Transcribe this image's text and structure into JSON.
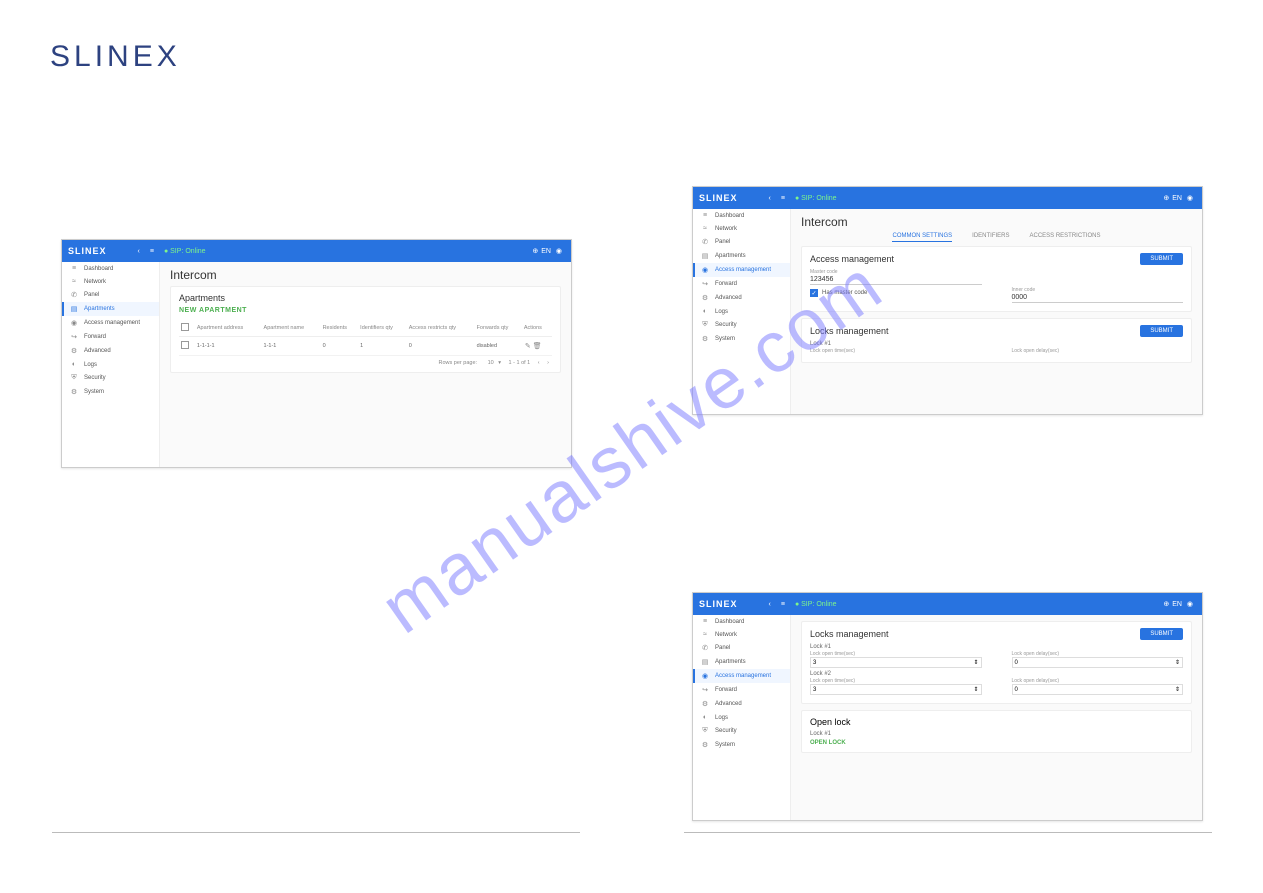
{
  "brand": "SLINEX",
  "watermark": "manualshive.com",
  "topbar": {
    "sip": "SIP: Online",
    "lang": "EN"
  },
  "sidebar": {
    "items": [
      {
        "icon": "≡",
        "label": "Dashboard"
      },
      {
        "icon": "≈",
        "label": "Network"
      },
      {
        "icon": "✆",
        "label": "Panel"
      },
      {
        "icon": "▤",
        "label": "Apartments"
      },
      {
        "icon": "◉",
        "label": "Access management"
      },
      {
        "icon": "↪",
        "label": "Forward"
      },
      {
        "icon": "⚙",
        "label": "Advanced"
      },
      {
        "icon": "◐",
        "label": "Logs"
      },
      {
        "icon": "⛨",
        "label": "Security"
      },
      {
        "icon": "⚙",
        "label": "System"
      }
    ]
  },
  "panel1": {
    "title": "Intercom",
    "section": "Apartments",
    "new_link": "NEW APARTMENT",
    "headers": [
      "",
      "Apartment address",
      "Apartment name",
      "Residents",
      "Identifiers qty",
      "Access restricts qty",
      "Forwards qty",
      "Actions"
    ],
    "row": {
      "addr": "1-1-1-1",
      "name": "1-1-1",
      "residents": "0",
      "idq": "1",
      "arq": "0",
      "fwq": "disabled"
    },
    "pager": {
      "rpp_label": "Rows per page:",
      "rpp": "10",
      "range": "1 - 1 of 1"
    }
  },
  "panel2": {
    "title": "Intercom",
    "tabs": [
      "COMMON SETTINGS",
      "IDENTIFIERS",
      "ACCESS RESTRICTIONS"
    ],
    "section1": {
      "title": "Access management",
      "submit": "SUBMIT",
      "master_code_label": "Master code",
      "master_code": "123456",
      "chk_label": "Has master code",
      "inner_label": "Inner code",
      "inner_val": "0000"
    },
    "section2": {
      "title": "Locks management",
      "submit": "SUBMIT",
      "lock1": "Lock #1",
      "f1": "Lock open time(sec)",
      "f2": "Lock open delay(sec)"
    }
  },
  "panel3": {
    "section1": {
      "title": "Locks management",
      "submit": "SUBMIT",
      "lock1": "Lock #1",
      "lock2": "Lock #2",
      "l_time": "Lock open time(sec)",
      "l_delay": "Lock open delay(sec)",
      "v_time": "3",
      "v_delay": "0"
    },
    "section2": {
      "title": "Open lock",
      "lock1": "Lock #1",
      "open": "OPEN LOCK"
    }
  }
}
